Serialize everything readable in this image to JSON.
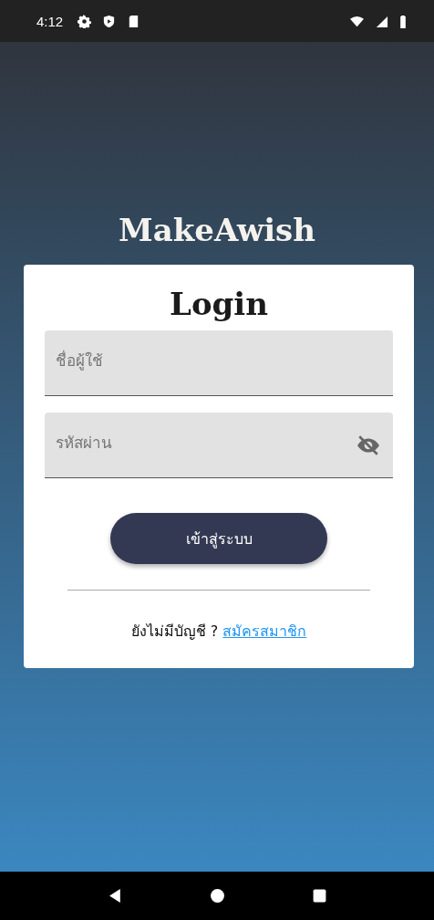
{
  "status_bar": {
    "time": "4:12"
  },
  "app_title": "MakeAwish",
  "login_card": {
    "title": "Login",
    "fields": [
      {
        "kind": "text",
        "placeholder": "ชื่อผู้ใช้"
      },
      {
        "kind": "password",
        "placeholder": "รหัสผ่าน",
        "password_visible": false
      }
    ],
    "submit_button": "เข้าสู่ระบบ",
    "signup_prompt": "ยังไม่มีบัญชี ?",
    "signup_link": "สมัครสมาชิก"
  }
}
